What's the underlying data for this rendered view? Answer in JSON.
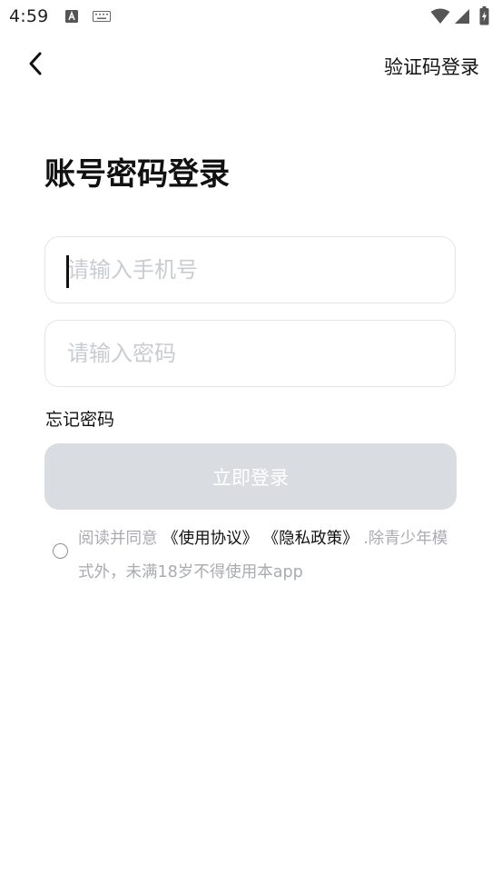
{
  "status_bar": {
    "time": "4:59",
    "icons": [
      "text-input-icon",
      "keyboard-icon",
      "wifi-icon",
      "cell-signal-icon",
      "battery-charging-icon"
    ]
  },
  "header": {
    "back_icon": "chevron-left-icon",
    "switch_login_label": "验证码登录"
  },
  "title": "账号密码登录",
  "form": {
    "phone_placeholder": "请输入手机号",
    "phone_value": "",
    "password_placeholder": "请输入密码",
    "password_value": "",
    "forgot_password": "忘记密码",
    "submit_label": "立即登录"
  },
  "agreement": {
    "checked": false,
    "prefix": "阅读并同意",
    "terms_link": "《使用协议》",
    "privacy_link": "《隐私政策》",
    "suffix": ".除青少年模式外，未满18岁不得使用本app"
  },
  "colors": {
    "button_disabled": "#d9dce0",
    "input_border": "#e3e5e8",
    "placeholder": "#c9ccd1",
    "muted_text": "#a8abb0"
  }
}
